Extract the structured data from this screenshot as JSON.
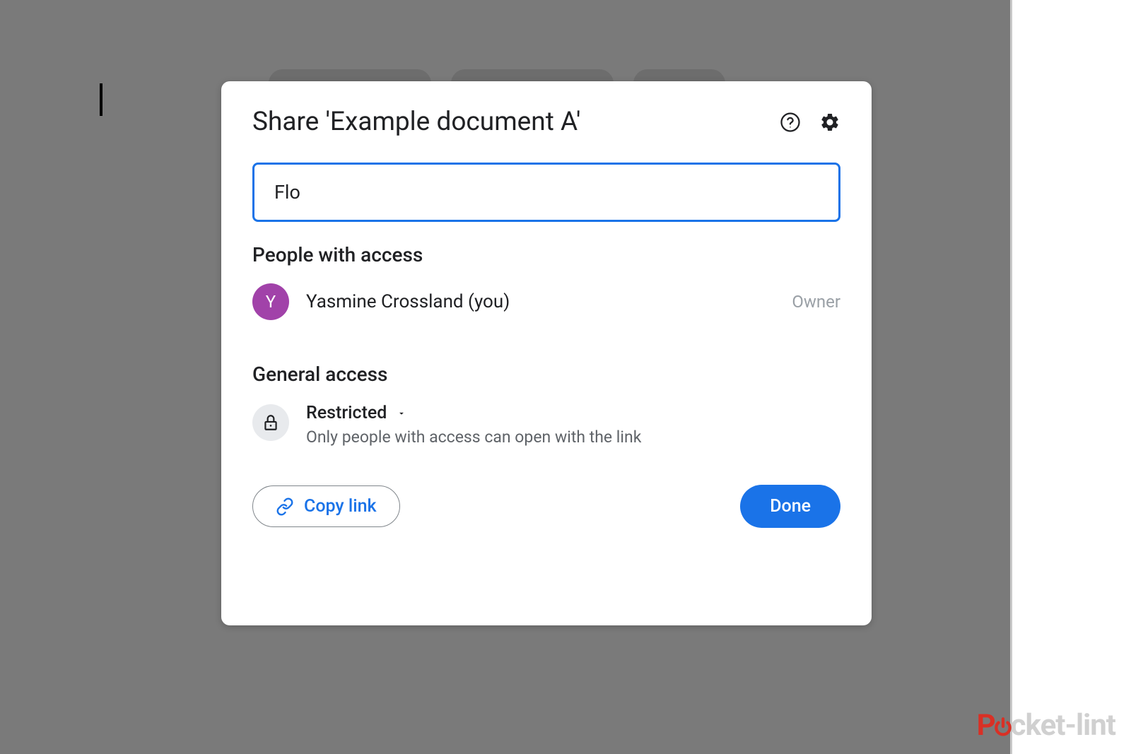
{
  "dialog": {
    "title": "Share 'Example document A'",
    "input_value": "Flo",
    "people_section_title": "People with access",
    "general_section_title": "General access",
    "copy_link_label": "Copy link",
    "done_label": "Done"
  },
  "people": [
    {
      "avatar_initial": "Y",
      "name": "Yasmine Crossland (you)",
      "role": "Owner"
    }
  ],
  "general_access": {
    "level": "Restricted",
    "description": "Only people with access can open with the link"
  },
  "watermark": {
    "prefix": "P",
    "suffix": "cket-lint"
  }
}
